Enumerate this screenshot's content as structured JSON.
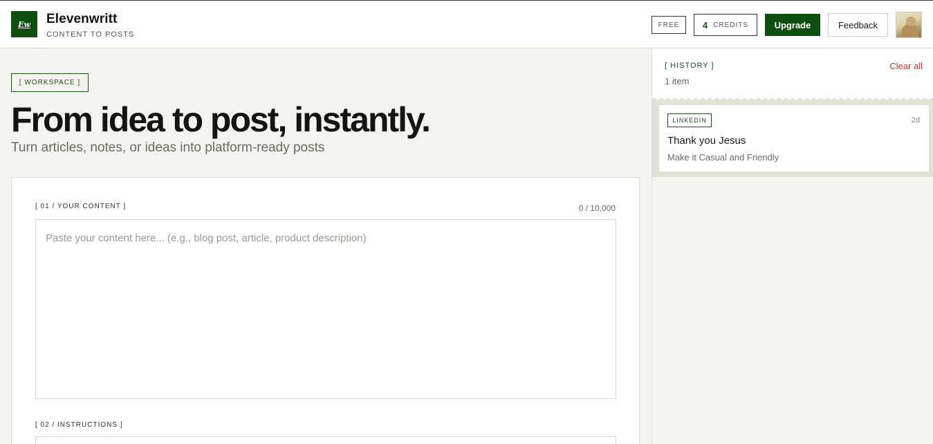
{
  "header": {
    "logo_text": "Ew",
    "brand_name": "Elevenwritt",
    "brand_sub": "CONTENT TO POSTS",
    "plan_label": "FREE",
    "credits_count": "4",
    "credits_label": "CREDITS",
    "upgrade_label": "Upgrade",
    "feedback_label": "Feedback"
  },
  "main": {
    "workspace_tag": "[ WORKSPACE ]",
    "title": "From idea to post, instantly.",
    "subtitle": "Turn articles, notes, or ideas into platform-ready posts",
    "content_label": "[ 01 / YOUR CONTENT ]",
    "char_count": "0 / 10,000",
    "content_placeholder": "Paste your content here... (e.g., blog post, article, product description)",
    "content_value": "",
    "instructions_label": "[ 02 / INSTRUCTIONS ]"
  },
  "sidebar": {
    "history_tag": "[ HISTORY ]",
    "history_count": "1 item",
    "clear_all_label": "Clear all",
    "items": [
      {
        "platform": "LINKEDIN",
        "age": "2d",
        "title": "Thank you Jesus",
        "subtitle": "Make it Casual and Friendly"
      }
    ]
  },
  "colors": {
    "brand_green": "#0d4d0d",
    "page_bg": "#f3f4ef",
    "danger_red": "#c0392b"
  }
}
